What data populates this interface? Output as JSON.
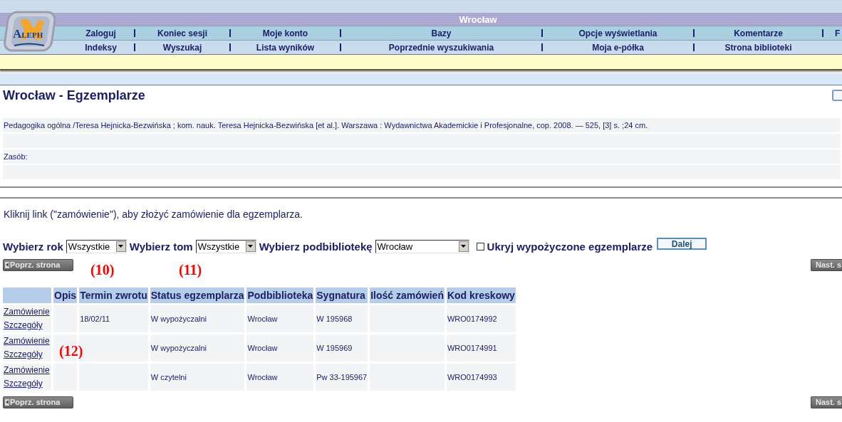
{
  "header": {
    "logo": "ALEPH",
    "title": "Wrocław",
    "menu_rows": [
      [
        "Zaloguj",
        "Koniec sesji",
        "Moje konto",
        "Bazy",
        "Opcje wyświetlania",
        "Komentarze",
        "F"
      ],
      [
        "Indeksy",
        "Wyszukaj",
        "Lista wyników",
        "Poprzednie wyszukiwania",
        "Moja e-półka",
        "Strona biblioteki"
      ]
    ]
  },
  "page_title": "Wrocław - Egzemplarze",
  "record": {
    "description": "Pedagogika ogólna /Teresa Hejnicka-Bezwińska ; kom. nauk. Teresa Hejnicka-Bezwińska [et al.].  Warszawa : Wydawnictwa Akademickie i Profesjonalne, cop. 2008. —   525, [3] s. ;24 cm.",
    "holdings_label": "Zasób:"
  },
  "instruction": "Kliknij link (\"zamówienie\"), aby złożyć zamówienie dla egzemplarza.",
  "filters": {
    "year": {
      "label": "Wybierz rok",
      "value": "Wszystkie"
    },
    "volume": {
      "label": "Wybierz tom",
      "value": "Wszystkie"
    },
    "sublibrary": {
      "label": "Wybierz podbibliotekę",
      "value": "Wrocław"
    },
    "hide_loaned": {
      "label": "Ukryj wypożyczone egzemplarze",
      "checked": false
    },
    "submit": "Dalej"
  },
  "pager_top": {
    "prev": "Poprz. strona",
    "next": "Nast. s"
  },
  "table": {
    "columns": [
      "Opis",
      "Termin zwrotu",
      "Status egzemplarza",
      "Podbiblioteka",
      "Sygnatura",
      "Ilość zamówień",
      "Kod kreskowy"
    ],
    "rows": [
      {
        "links": [
          "Zamówienie",
          "Szczegóły"
        ],
        "cells": [
          null,
          "18/02/11",
          "W wypożyczalni",
          "Wrocław",
          "W 195968",
          null,
          "WRO0174992"
        ]
      },
      {
        "links": [
          "Zamówienie",
          "Szczegóły"
        ],
        "cells": [
          null,
          null,
          "W wypożyczalni",
          "Wrocław",
          "W 195969",
          null,
          "WRO0174991"
        ]
      },
      {
        "links": [
          "Zamówienie",
          "Szczegóły"
        ],
        "cells": [
          null,
          null,
          "W czytelni",
          "Wrocław",
          "Pw 33-195967",
          null,
          "WRO0174993"
        ]
      }
    ]
  },
  "pager_bottom": {
    "prev": "Poprz. strona",
    "next": "Nast. s"
  },
  "annotations": [
    "(10)",
    "(11)",
    "(12)"
  ]
}
